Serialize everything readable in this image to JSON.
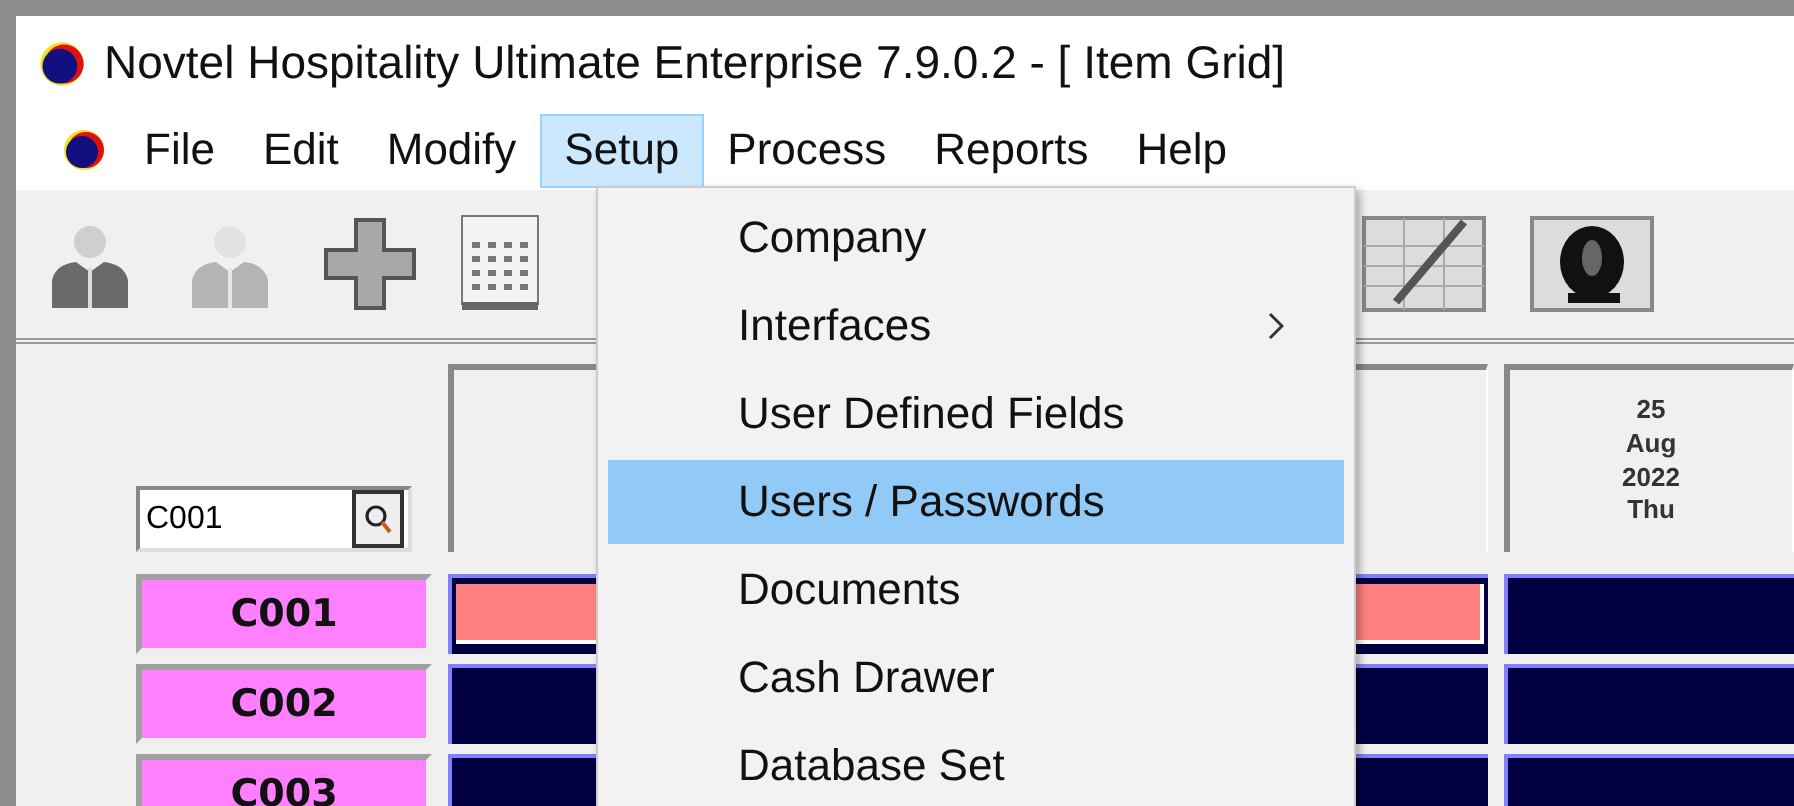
{
  "window": {
    "title": "Novtel Hospitality Ultimate Enterprise 7.9.0.2 - [ Item Grid]"
  },
  "menu_bar": [
    {
      "label": "File",
      "selected": false
    },
    {
      "label": "Edit",
      "selected": false
    },
    {
      "label": "Modify",
      "selected": false
    },
    {
      "label": "Setup",
      "selected": true
    },
    {
      "label": "Process",
      "selected": false
    },
    {
      "label": "Reports",
      "selected": false
    },
    {
      "label": "Help",
      "selected": false
    }
  ],
  "setup_menu": {
    "items": [
      {
        "label": "Company",
        "selected": false,
        "has_submenu": false
      },
      {
        "label": "Interfaces",
        "selected": false,
        "has_submenu": true
      },
      {
        "label": "User Defined Fields",
        "selected": false,
        "has_submenu": false
      },
      {
        "label": "Users / Passwords",
        "selected": true,
        "has_submenu": false
      },
      {
        "label": "Documents",
        "selected": false,
        "has_submenu": false
      },
      {
        "label": "Cash Drawer",
        "selected": false,
        "has_submenu": false
      },
      {
        "label": "Database Set",
        "selected": false,
        "has_submenu": false
      }
    ]
  },
  "grid": {
    "search": {
      "value": "C001"
    },
    "columns": [
      {},
      {
        "heading_lines": [
          "25",
          "Aug",
          "2022",
          "Thu"
        ]
      }
    ],
    "rows": [
      {
        "label": "C001",
        "cells": [
          {
            "kind": "booking"
          },
          {
            "kind": "empty"
          }
        ]
      },
      {
        "label": "C002",
        "cells": [
          {
            "kind": "empty"
          },
          {
            "kind": "empty"
          }
        ]
      },
      {
        "label": "C003",
        "cells": [
          {
            "kind": "empty"
          },
          {
            "kind": "empty"
          }
        ]
      }
    ]
  }
}
